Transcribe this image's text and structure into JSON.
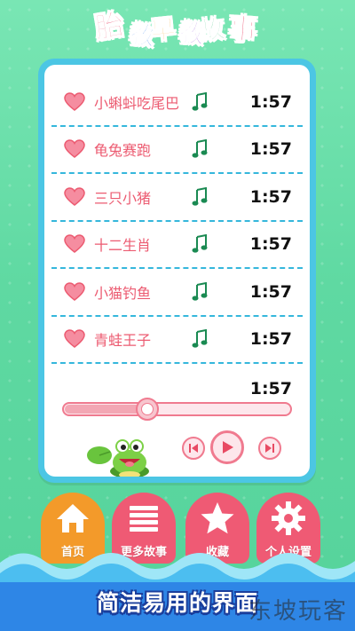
{
  "app": {
    "title_chars": [
      "胎",
      "教",
      "早",
      "教",
      "故",
      "事"
    ],
    "title_colors": [
      "#e83a5e",
      "#2a7ae8",
      "#f2a21c",
      "#8a47d6",
      "#21b36b",
      "#e83a5e"
    ]
  },
  "player": {
    "songs": [
      {
        "title": "小蝌蚪吃尾巴",
        "duration": "1:57",
        "favorited": true
      },
      {
        "title": "龟兔赛跑",
        "duration": "1:57",
        "favorited": true
      },
      {
        "title": "三只小猪",
        "duration": "1:57",
        "favorited": true
      },
      {
        "title": "十二生肖",
        "duration": "1:57",
        "favorited": true
      },
      {
        "title": "小猫钓鱼",
        "duration": "1:57",
        "favorited": true
      },
      {
        "title": "青蛙王子",
        "duration": "1:57",
        "favorited": true
      }
    ],
    "current_time": "1:57",
    "progress_fraction": 0.37,
    "controls": {
      "prev_icon": "skip-previous-icon",
      "play_icon": "play-icon",
      "next_icon": "skip-next-icon"
    }
  },
  "nav": {
    "items": [
      {
        "label": "首页",
        "icon": "home-icon",
        "color": "#f39a2a"
      },
      {
        "label": "更多故事",
        "icon": "list-icon",
        "color": "#ef5a74"
      },
      {
        "label": "收藏",
        "icon": "star-icon",
        "color": "#ef5a74"
      },
      {
        "label": "个人设置",
        "icon": "gear-icon",
        "color": "#ef5a74"
      }
    ]
  },
  "caption": "简洁易用的界面",
  "watermark": "东坡玩客",
  "colors": {
    "accent_pink": "#ec5b71",
    "card_border": "#4cc6e4",
    "background": "#5fd9a2",
    "home_orange": "#f39a2a"
  }
}
